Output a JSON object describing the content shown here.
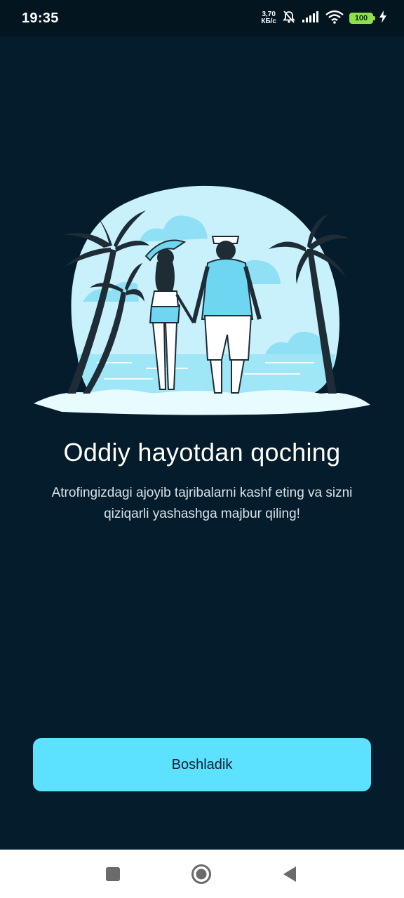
{
  "status_bar": {
    "time": "19:35",
    "net_speed_value": "3,70",
    "net_speed_unit": "КБ/с",
    "battery_level": "100",
    "icons": [
      "mute-icon",
      "signal-icon",
      "wifi-icon",
      "battery-icon",
      "charging-icon"
    ]
  },
  "onboarding": {
    "title": "Oddiy hayotdan qoching",
    "description": "Atrofingizdagi ajoyib tajribalarni kashf eting va sizni qiziqarli yashashga majbur qiling!",
    "start_button_label": "Boshladik"
  },
  "nav_bar": {
    "icons": [
      "recents-icon",
      "home-icon",
      "back-icon"
    ]
  },
  "colors": {
    "background": "#041c2c",
    "accent": "#5ce1ff",
    "illustration_light": "#c9f1fb",
    "illustration_mid": "#6fd6f2",
    "silhouette": "#1e2c36"
  }
}
